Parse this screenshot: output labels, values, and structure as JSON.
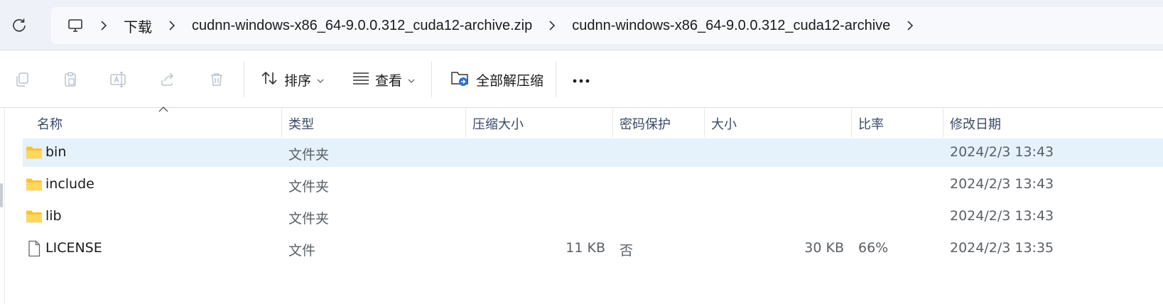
{
  "address_bar": {
    "crumbs": [
      "下载",
      "cudnn-windows-x86_64-9.0.0.312_cuda12-archive.zip",
      "cudnn-windows-x86_64-9.0.0.312_cuda12-archive"
    ]
  },
  "toolbar": {
    "sort_label": "排序",
    "view_label": "查看",
    "extract_all_label": "全部解压缩",
    "more_label": "···"
  },
  "columns": {
    "name": "名称",
    "type": "类型",
    "compressed_size": "压缩大小",
    "password_protected": "密码保护",
    "size": "大小",
    "ratio": "比率",
    "modified": "修改日期"
  },
  "files": [
    {
      "name": "bin",
      "type": "文件夹",
      "compressed_size": "",
      "password": "",
      "size": "",
      "ratio": "",
      "modified": "2024/2/3 13:43",
      "kind": "folder",
      "selected": true
    },
    {
      "name": "include",
      "type": "文件夹",
      "compressed_size": "",
      "password": "",
      "size": "",
      "ratio": "",
      "modified": "2024/2/3 13:43",
      "kind": "folder",
      "selected": false
    },
    {
      "name": "lib",
      "type": "文件夹",
      "compressed_size": "",
      "password": "",
      "size": "",
      "ratio": "",
      "modified": "2024/2/3 13:43",
      "kind": "folder",
      "selected": false
    },
    {
      "name": "LICENSE",
      "type": "文件",
      "compressed_size": "11 KB",
      "password": "否",
      "size": "30 KB",
      "ratio": "66%",
      "modified": "2024/2/3 13:35",
      "kind": "file",
      "selected": false
    }
  ],
  "colors": {
    "selection": "#e5f1fb",
    "folder_yellow": "#f5c33b",
    "accent_blue": "#2a72d6"
  },
  "icons": {
    "refresh": "refresh-icon",
    "this_pc": "monitor-icon",
    "copy": "copy-icon",
    "paste": "paste-icon",
    "rename": "rename-icon",
    "share": "share-icon",
    "delete": "delete-icon",
    "sort": "sort-icon",
    "view": "view-icon",
    "extract": "extract-folder-icon",
    "folder": "folder-icon",
    "file": "file-icon"
  }
}
